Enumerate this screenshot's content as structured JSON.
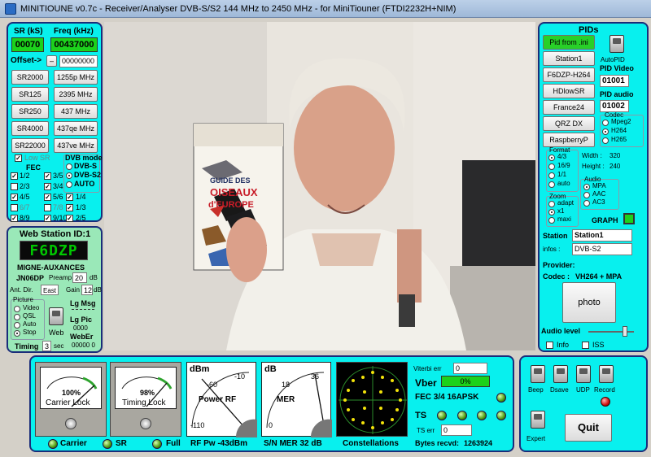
{
  "window": {
    "title": "MINITIOUNE v0.7c - Receiver/Analyser DVB-S/S2 144 MHz to 2450 MHz - for MiniTiouner (FTDI2232H+NIM)"
  },
  "tuning": {
    "sr_label": "SR (kS)",
    "freq_label": "Freq (kHz)",
    "sr_value": "00070",
    "freq_value": "00437000",
    "offset_label": "Offset->",
    "offset_sign": "–",
    "offset_value": "00000000",
    "presets": [
      {
        "sr": "SR2000",
        "freq": "1255p MHz"
      },
      {
        "sr": "SR125",
        "freq": "2395 MHz"
      },
      {
        "sr": "SR250",
        "freq": "437 MHz"
      },
      {
        "sr": "SR4000",
        "freq": "437qe MHz"
      },
      {
        "sr": "SR22000",
        "freq": "437ve MHz"
      }
    ],
    "low_sr": "Low SR",
    "fec_title": "FEC",
    "fec_left": [
      "1/2",
      "2/3",
      "4/5",
      "6/7",
      "8/9"
    ],
    "fec_mid": [
      "3/5",
      "3/4",
      "5/6",
      "7/8",
      "9/10"
    ],
    "dvb_title": "DVB mode",
    "dvb_modes": [
      "DVB-S",
      "DVB-S2",
      "AUTO"
    ],
    "fec_right": [
      "1/4",
      "1/3",
      "2/5"
    ]
  },
  "station": {
    "title": "Web Station ID:1",
    "lcd": "F6DZP",
    "locator_name": "MIGNE-AUXANCES",
    "locator": "JN06DP",
    "preamp_label": "Preamp",
    "preamp_value": "20",
    "preamp_unit": "dB",
    "antdir_label": "Ant. Dir.",
    "antdir_value": "East",
    "gain_label": "Gain",
    "gain_value": "12",
    "gain_unit": "dB",
    "picture_label": "Picture",
    "picture_options": [
      "Video",
      "QSL",
      "Auto",
      "Stop"
    ],
    "lg_msg": "Lg Msg",
    "lg_pic": "Lg Pic",
    "lg_pic_value": "0000",
    "web_label": "Web",
    "weber_label": "WebEr",
    "weber_value": "00000 0",
    "timing_label": "Timing",
    "timing_value": "3",
    "timing_unit": "sec"
  },
  "pids": {
    "title": "PIDs",
    "buttons": [
      "Pid from .ini",
      "Station1",
      "F6DZP-H264",
      "HDlowSR",
      "France24",
      "QRZ DX",
      "RaspberryP"
    ],
    "autopid": "AutoPID",
    "pid_video_label": "PID Video",
    "pid_video": "01001",
    "pid_audio_label": "PID audio",
    "pid_audio": "01002",
    "codec_label": "Codec",
    "codec_options": [
      "Mpeg2",
      "H264",
      "H265"
    ],
    "format_label": "Format",
    "format_options": [
      "4/3",
      "16/9",
      "1/1",
      "auto"
    ],
    "width_label": "Width :",
    "width_value": "320",
    "height_label": "Height :",
    "height_value": "240",
    "audio_label": "Audio",
    "audio_options": [
      "MPA",
      "AAC",
      "AC3"
    ],
    "zoom_label": "Zoom",
    "zoom_options": [
      "adapt",
      "x1",
      "maxi"
    ],
    "graph": "GRAPH",
    "station_label": "Station",
    "station_value": "Station1",
    "infos_label": "infos :",
    "infos_value": "DVB-S2",
    "provider_label": "Provider:",
    "codec_info_label": "Codec :",
    "codec_info_value": "VH264 + MPA",
    "photo": "photo",
    "audio_level": "Audio level",
    "audio_level_fraction": 0.8,
    "info_label": "Info",
    "iss_label": "ISS"
  },
  "book": {
    "line1": "GUIDE DES",
    "line2": "OISEAUX",
    "line3": "d'EUROPE"
  },
  "meters": {
    "carrier_pct": "100%",
    "carrier_label": "Carrier Lock",
    "timing_pct": "98%",
    "timing_label": "Timing Lock",
    "rf_unit": "dBm",
    "rf_ticks": [
      "-60",
      "-10",
      "-110"
    ],
    "rf_label": "Power RF",
    "mer_unit": "dB",
    "mer_ticks": [
      "18",
      "36",
      "0"
    ],
    "mer_label": "MER",
    "lamps": [
      "Carrier",
      "SR",
      "Full"
    ],
    "rf_pw": "RF Pw  -43dBm",
    "sn_mer": "S/N MER   32 dB",
    "constellations": "Constellations"
  },
  "status": {
    "viterbi_label": "Viterbi err",
    "viterbi_value": "0",
    "vber_label": "Vber",
    "vber_value": "0%",
    "fec_line": "FEC 3/4 16APSK",
    "ts_label": "TS",
    "ts_err_label": "TS err",
    "ts_err_value": "0",
    "bytes_label": "Bytes recvd:",
    "bytes_value": "1263924"
  },
  "controls": {
    "toggles": [
      "Beep",
      "Dsave",
      "UDP",
      "Record"
    ],
    "expert": "Expert",
    "quit": "Quit"
  },
  "colors": {
    "panel": "#08f0ee",
    "border": "#1a2d7a",
    "lcd": "#00c800",
    "display": "#1cd21c"
  }
}
